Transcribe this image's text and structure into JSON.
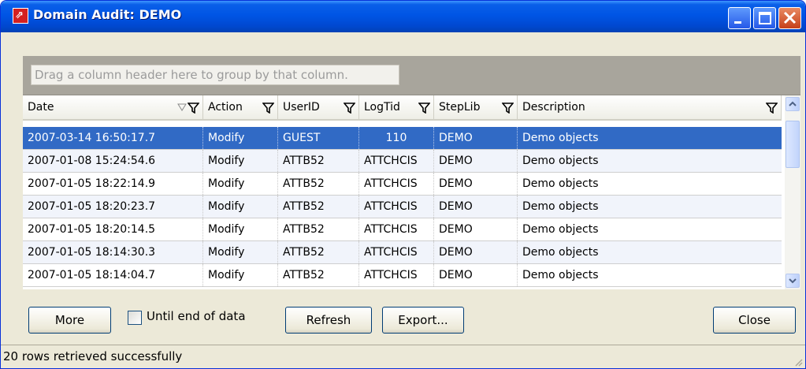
{
  "window": {
    "title": "Domain Audit: DEMO",
    "icon": "app-window-icon",
    "accent": "#0055e5"
  },
  "group_panel": {
    "hint": "Drag a column header here to group by that column."
  },
  "grid": {
    "columns": [
      "Date",
      "Action",
      "UserID",
      "LogTid",
      "StepLib",
      "Description"
    ],
    "selected_row": 0,
    "rows": [
      [
        "2007-03-14 16:50:17.7",
        "Modify",
        "GUEST",
        "110",
        "DEMO",
        "Demo objects"
      ],
      [
        "2007-01-08 15:24:54.6",
        "Modify",
        "ATTB52",
        "ATTCHCIS",
        "DEMO",
        "Demo objects"
      ],
      [
        "2007-01-05 18:22:14.9",
        "Modify",
        "ATTB52",
        "ATTCHCIS",
        "DEMO",
        "Demo objects"
      ],
      [
        "2007-01-05 18:20:23.7",
        "Modify",
        "ATTB52",
        "ATTCHCIS",
        "DEMO",
        "Demo objects"
      ],
      [
        "2007-01-05 18:20:14.5",
        "Modify",
        "ATTB52",
        "ATTCHCIS",
        "DEMO",
        "Demo objects"
      ],
      [
        "2007-01-05 18:14:30.3",
        "Modify",
        "ATTB52",
        "ATTCHCIS",
        "DEMO",
        "Demo objects"
      ],
      [
        "2007-01-05 18:14:04.7",
        "Modify",
        "ATTB52",
        "ATTCHCIS",
        "DEMO",
        "Demo objects"
      ]
    ]
  },
  "buttons": {
    "more": "More",
    "refresh": "Refresh",
    "export": "Export...",
    "close": "Close"
  },
  "checkbox": {
    "label": "Until end of data",
    "checked": false
  },
  "status": {
    "text": "20 rows retrieved successfully"
  },
  "colors": {
    "selection": "#316ac5",
    "alt_row": "#f1f4fb",
    "group_panel": "#a8a59c"
  }
}
